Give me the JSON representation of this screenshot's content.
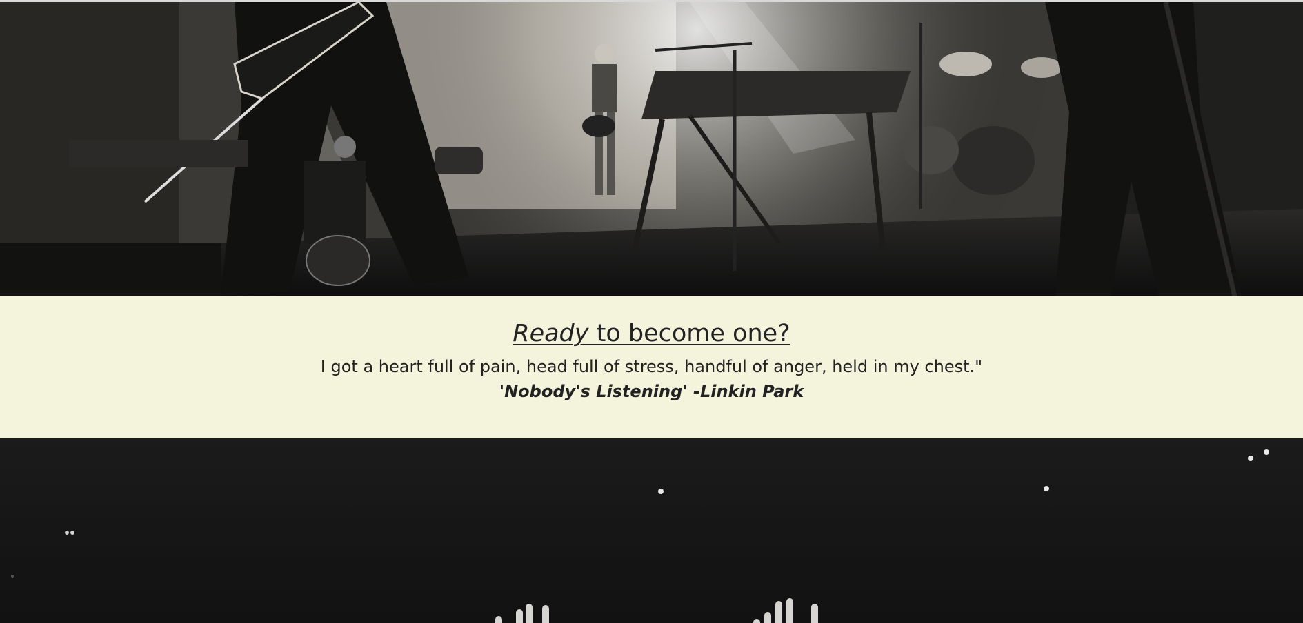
{
  "hero": {
    "image": "concert-stage-photo",
    "icon": "band-on-stage-image"
  },
  "quote": {
    "headline_emphasis": "Ready",
    "headline_rest": " to become one?",
    "lyric": "I got a heart full of pain, head full of stress, handful of anger, held in my chest.\"",
    "attribution": "'Nobody's Listening' -Linkin Park"
  },
  "crowd": {
    "image": "crowd-hands-photo"
  },
  "colors": {
    "band_background": "#f4f3dc",
    "text": "#222222"
  }
}
